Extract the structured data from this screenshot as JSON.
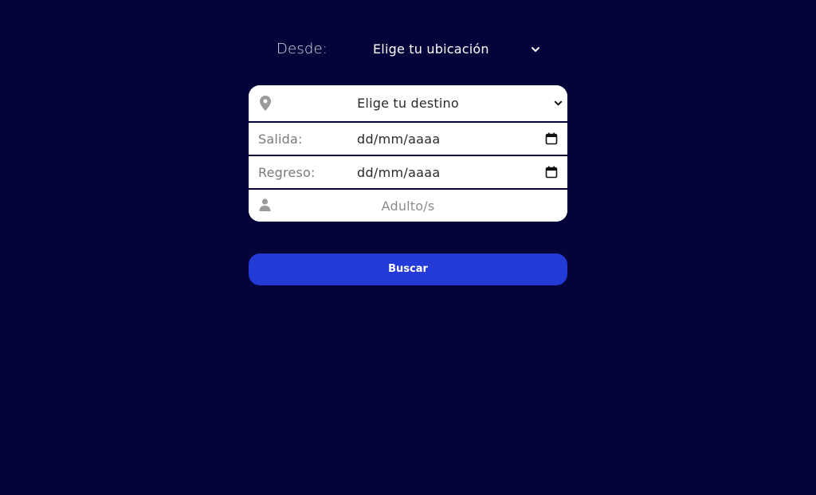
{
  "origin": {
    "label": "Desde:",
    "selected": "Elige tu ubicación",
    "icon": "chevron-down-icon"
  },
  "form": {
    "destination": {
      "icon": "map-pin-icon",
      "selected": "Elige tu destino"
    },
    "departure": {
      "label": "Salida:",
      "value": "dd/mm/aaaa",
      "icon": "calendar-icon"
    },
    "return": {
      "label": "Regreso:",
      "value": "dd/mm/aaaa",
      "icon": "calendar-icon"
    },
    "passengers": {
      "icon": "person-icon",
      "placeholder": "Adulto/s"
    }
  },
  "search_button": {
    "label": "Buscar"
  },
  "colors": {
    "background": "#04043a",
    "button": "#243ad6",
    "card": "#ffffff",
    "icon": "#9a9a9a"
  }
}
